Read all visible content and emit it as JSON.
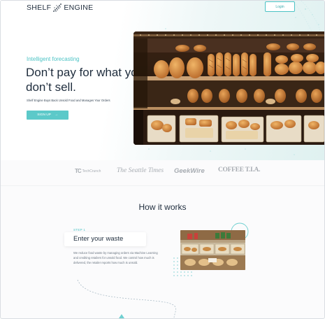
{
  "header": {
    "logo_text_left": "SHELF",
    "logo_text_right": "ENGINE",
    "login_label": "Login"
  },
  "hero": {
    "eyebrow": "Intelligent forecasting",
    "headline": "Don’t pay for what you don’t sell.",
    "subheadline": "Shelf Engine Buys Back Unsold Food and Manages Your Orders",
    "cta_label": "SIGN UP",
    "cta_arrow": "→"
  },
  "press": {
    "techcrunch": "TechCrunch",
    "techcrunch_mark": "TC",
    "seattle_times": "The Seattle Times",
    "geekwire": "GeekWire",
    "coffee_tv": "COFFEE T.I.A."
  },
  "how_it_works": {
    "title": "How it works",
    "step_label": "STEP 1",
    "step_title": "Enter your waste",
    "step_description": "We reduce food waste by managing orders via Machine Learning and crediting retailers for unsold food. We control how much is delivered, the retailer reports how much is unsold."
  },
  "colors": {
    "accent": "#4cc3c5",
    "dark_text": "#1f2d3d",
    "muted_text": "#a7acb2"
  }
}
